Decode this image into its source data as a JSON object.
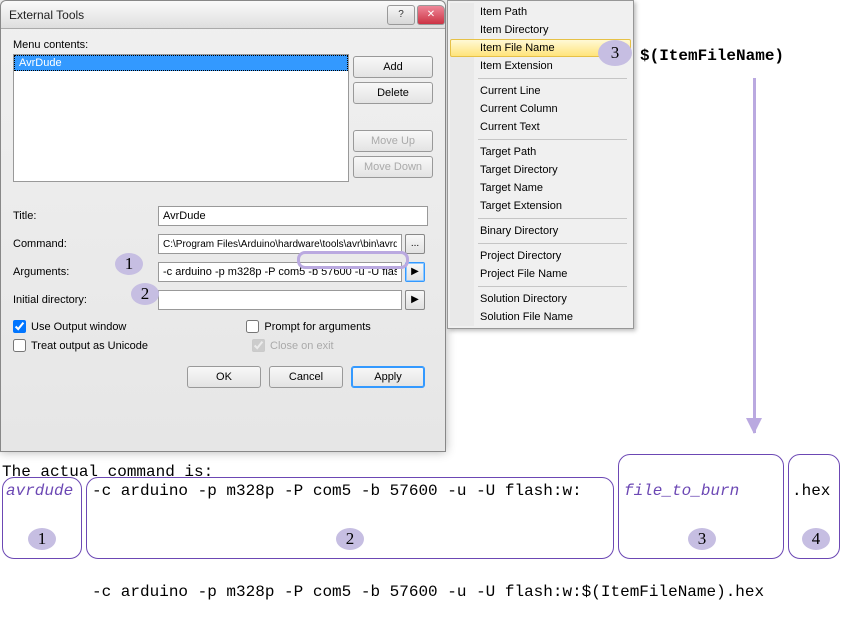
{
  "dialog": {
    "title": "External Tools",
    "menu_contents_label": "Menu contents:",
    "list_item": "AvrDude",
    "buttons": {
      "add": "Add",
      "delete": "Delete",
      "move_up": "Move Up",
      "move_down": "Move Down"
    },
    "fields": {
      "title_label": "Title:",
      "title_value": "AvrDude",
      "command_label": "Command:",
      "command_value": "C:\\Program Files\\Arduino\\hardware\\tools\\avr\\bin\\avrdude.exe",
      "arguments_label": "Arguments:",
      "arguments_value": "-c arduino -p m328p -P com5 -b 57600 -u -U flas",
      "initdir_label": "Initial directory:",
      "initdir_value": ""
    },
    "checks": {
      "use_output": "Use Output window",
      "prompt_args": "Prompt for arguments",
      "unicode": "Treat output as Unicode",
      "close_exit": "Close on exit"
    },
    "footer": {
      "ok": "OK",
      "cancel": "Cancel",
      "apply": "Apply"
    }
  },
  "menu": {
    "items": [
      "Item Path",
      "Item Directory",
      "Item File Name",
      "Item Extension",
      "Current Line",
      "Current Column",
      "Current Text",
      "Target Path",
      "Target Directory",
      "Target Name",
      "Target Extension",
      "Binary Directory",
      "Project Directory",
      "Project File Name",
      "Solution Directory",
      "Solution File Name"
    ],
    "hover_index": 2
  },
  "annot": {
    "badge1": "1",
    "badge2": "2",
    "badge3": "3",
    "badge4": "4",
    "item_file_name_macro": "$(ItemFileName)",
    "actual_cmd_label": "The actual command is:",
    "part1": "avrdude",
    "part2": "-c arduino -p m328p -P com5 -b 57600 -u -U flash:w:",
    "part3": "file_to_burn",
    "part4": ".hex",
    "final": "-c arduino -p m328p -P com5 -b 57600 -u -U flash:w:$(ItemFileName).hex"
  }
}
